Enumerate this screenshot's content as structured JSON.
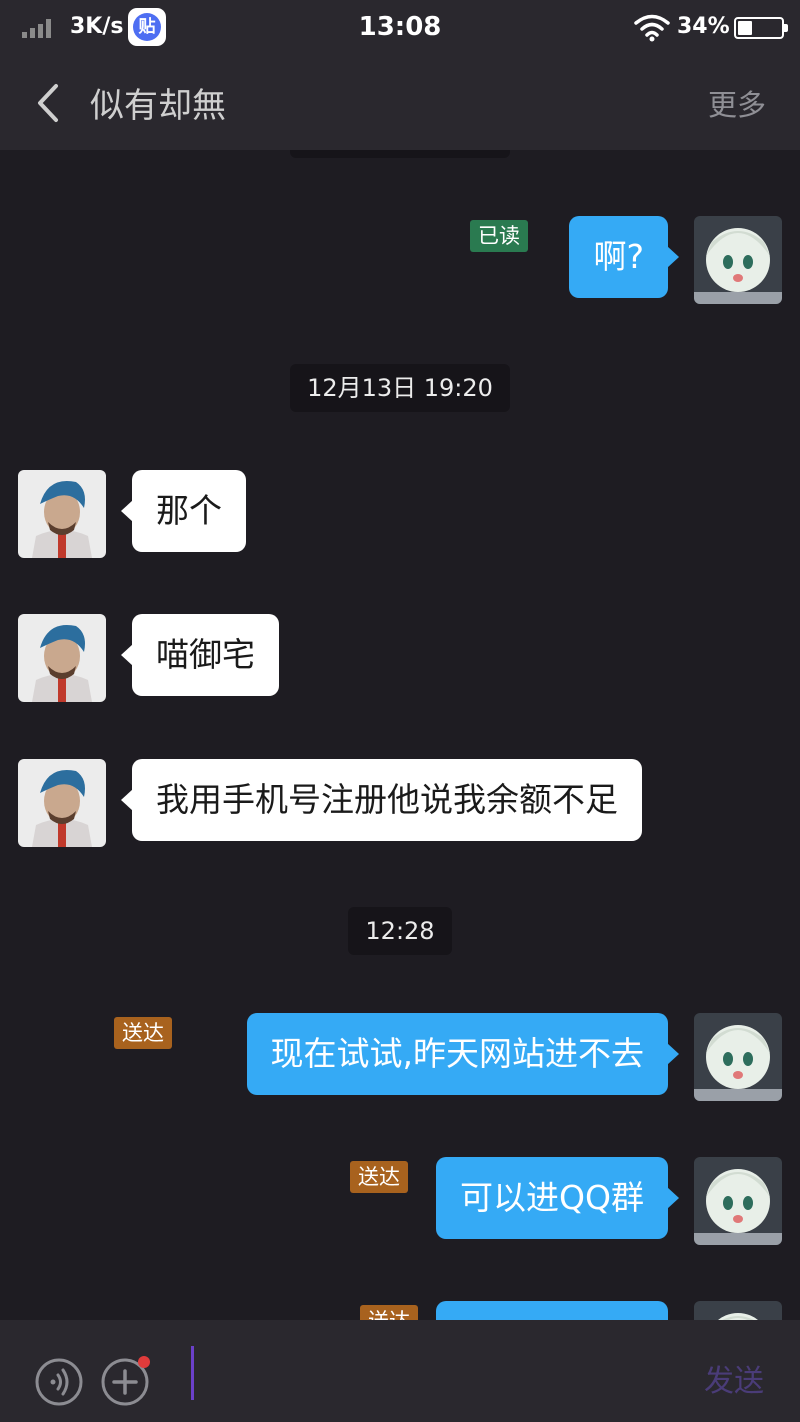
{
  "status_bar": {
    "net_speed": "3K/s",
    "tieba_icon_text": "贴",
    "time": "13:08",
    "battery_percent": "34%",
    "battery_level": 0.34
  },
  "header": {
    "title": "似有却無",
    "more_label": "更多"
  },
  "messages": [
    {
      "type": "out",
      "text": "啊?",
      "status": "已读"
    },
    {
      "type": "time",
      "text": "12月13日 19:20"
    },
    {
      "type": "in",
      "text": "那个"
    },
    {
      "type": "in",
      "text": "喵御宅"
    },
    {
      "type": "in",
      "text": "我用手机号注册他说我余额不足"
    },
    {
      "type": "time",
      "text": "12:28"
    },
    {
      "type": "out",
      "text": "现在试试,昨天网站进不去",
      "status": "送达"
    },
    {
      "type": "out",
      "text": "可以进QQ群",
      "status": "送达"
    },
    {
      "type": "out",
      "text": "",
      "status": "送达"
    }
  ],
  "input_bar": {
    "send_label": "发送"
  },
  "colors": {
    "background": "#1e1c22",
    "bar": "#2a282e",
    "outgoing_bubble": "#35aaf5",
    "incoming_bubble": "#ffffff",
    "read_badge": "#2a7a50",
    "sent_badge": "#a8621e"
  }
}
